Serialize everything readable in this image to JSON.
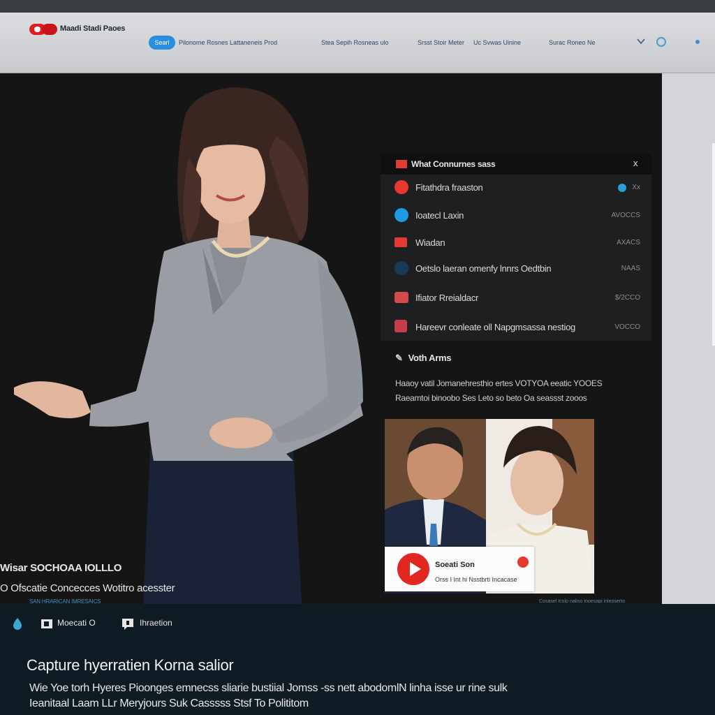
{
  "header": {
    "brand": "Maadi Stadi Paoes",
    "live_label": "Searl",
    "nav": [
      "Pilonome  Rosnes Lattaneneis Prod",
      "Stea Sepih Rosneas ulo",
      "Srsst Stoir Meter",
      "Uc Svwas Uinine",
      "Surac Roneo Ne"
    ],
    "icons": [
      "logo-icon",
      "chevron-down-icon",
      "search-icon",
      "menu-icon"
    ]
  },
  "notifications": {
    "title": "What Connurnes sass",
    "close": "x",
    "items": [
      {
        "text": "Fitathdra fraaston",
        "meta": "Xx",
        "icon": "red-circle-icon",
        "color": "#e8372c",
        "dot": true
      },
      {
        "text": "Ioatecl Laxin",
        "meta": "AVOCCS",
        "icon": "blue-circle-icon",
        "color": "#1c9be0",
        "dot": false
      },
      {
        "text": "Wiadan",
        "meta": "AXACS",
        "icon": "red-flag-icon",
        "color": "#e23a34",
        "dot": false
      },
      {
        "text": "Oetslo laeran omenfy lnnrs Oedtbin",
        "meta": "NAAS",
        "icon": "dark-globe-icon",
        "color": "#1a3a58",
        "dot": false
      },
      {
        "text": "Ifiator Rreialdacr",
        "meta": "$/2CCO",
        "icon": "flag-icon",
        "color": "#d24a4a",
        "dot": false
      },
      {
        "text": "Hareevr conleate oll Napgmsassa nestiog",
        "meta": "VOCCO",
        "icon": "flag-icon",
        "color": "#c43f4a",
        "dot": false
      }
    ]
  },
  "section": {
    "title": "Voth Arms",
    "desc": [
      "Haaoy vatil Jomanehresthio ertes VOTYOA eeatic YOOES",
      "Raeamtoi binoobo Ses Leto so beto Oa seassst zooos"
    ]
  },
  "overlay": {
    "line1": "Wisar SOCHOAA IOLLLO",
    "line2": "O Ofscatie Concecces Wotitro acesster",
    "line3": "SAN HRARICAN IMRESAICS"
  },
  "video": {
    "name": "Soeati Son",
    "sub": "Orss I Int hi Nsstbrti Incacase",
    "caption": "Cosasel Icolo naliso Inoesapi inleoserto"
  },
  "bottom": {
    "items": [
      {
        "label": "",
        "icon": "drop-icon"
      },
      {
        "label": "Moecati O",
        "icon": "camera-icon"
      },
      {
        "label": "Ihraetion",
        "icon": "chat-icon"
      }
    ],
    "title": "Capture hyerratien Korna salior",
    "lines": [
      "Wie Yoe torh Hyeres Pioonges emnecss sliarie bustiial Jomss -ss nett abodomlN linha isse ur rine sulk",
      "Ieanitaal Laam LLr Meryjours Suk Casssss Stsf To Polititom"
    ]
  }
}
